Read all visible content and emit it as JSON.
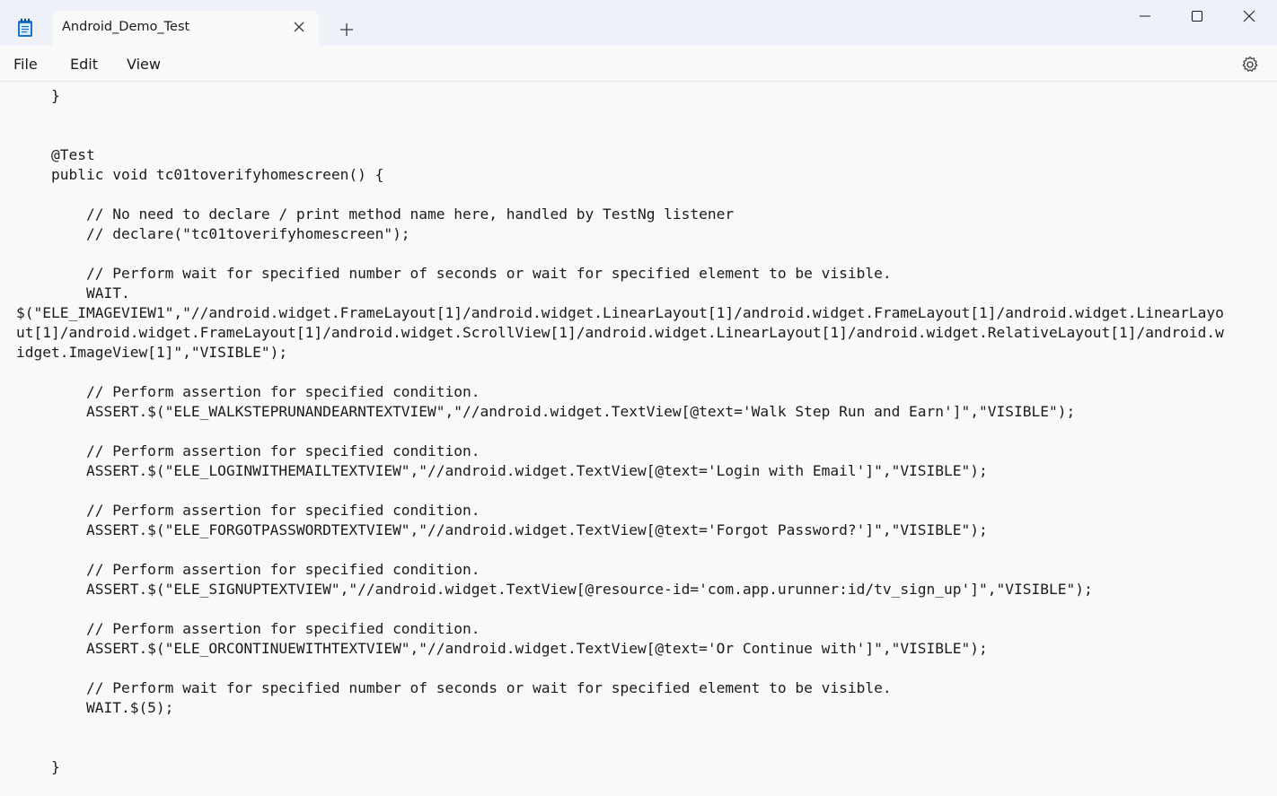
{
  "window": {
    "tab_title": "Android_Demo_Test",
    "icons": {
      "app": "notepad-icon",
      "tab_close": "close-icon",
      "new_tab": "plus-icon",
      "minimize": "minimize-icon",
      "maximize": "maximize-icon",
      "close": "close-icon",
      "settings": "gear-icon"
    }
  },
  "menu": {
    "file": "File",
    "edit": "Edit",
    "view": "View"
  },
  "editor": {
    "lines": [
      "    }",
      "",
      "",
      "    @Test",
      "    public void tc01toverifyhomescreen() {",
      "",
      "        // No need to declare / print method name here, handled by TestNg listener",
      "        // declare(\"tc01toverifyhomescreen\");",
      "",
      "        // Perform wait for specified number of seconds or wait for specified element to be visible.",
      "        WAIT.",
      "$(\"ELE_IMAGEVIEW1\",\"//android.widget.FrameLayout[1]/android.widget.LinearLayout[1]/android.widget.FrameLayout[1]/android.widget.LinearLayo",
      "ut[1]/android.widget.FrameLayout[1]/android.widget.ScrollView[1]/android.widget.LinearLayout[1]/android.widget.RelativeLayout[1]/android.w",
      "idget.ImageView[1]\",\"VISIBLE\");",
      "",
      "        // Perform assertion for specified condition.",
      "        ASSERT.$(\"ELE_WALKSTEPRUNANDEARNTEXTVIEW\",\"//android.widget.TextView[@text='Walk Step Run and Earn']\",\"VISIBLE\");",
      "",
      "        // Perform assertion for specified condition.",
      "        ASSERT.$(\"ELE_LOGINWITHEMAILTEXTVIEW\",\"//android.widget.TextView[@text='Login with Email']\",\"VISIBLE\");",
      "",
      "        // Perform assertion for specified condition.",
      "        ASSERT.$(\"ELE_FORGOTPASSWORDTEXTVIEW\",\"//android.widget.TextView[@text='Forgot Password?']\",\"VISIBLE\");",
      "",
      "        // Perform assertion for specified condition.",
      "        ASSERT.$(\"ELE_SIGNUPTEXTVIEW\",\"//android.widget.TextView[@resource-id='com.app.urunner:id/tv_sign_up']\",\"VISIBLE\");",
      "",
      "        // Perform assertion for specified condition.",
      "        ASSERT.$(\"ELE_ORCONTINUEWITHTEXTVIEW\",\"//android.widget.TextView[@text='Or Continue with']\",\"VISIBLE\");",
      "",
      "        // Perform wait for specified number of seconds or wait for specified element to be visible.",
      "        WAIT.$(5);",
      "",
      "",
      "    }"
    ]
  }
}
